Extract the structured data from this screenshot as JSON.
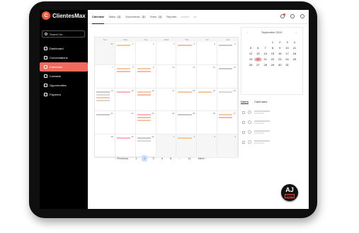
{
  "brand": {
    "name": "ClientesMax",
    "logo_letter": "C"
  },
  "sidebar": {
    "search_placeholder": "Search for...",
    "items": [
      {
        "label": "Dashboard",
        "icon": "home-icon"
      },
      {
        "label": "Conversations",
        "icon": "chat-icon"
      },
      {
        "label": "Calendars",
        "icon": "calendar-icon",
        "active": true
      },
      {
        "label": "Contacts",
        "icon": "contacts-icon"
      },
      {
        "label": "Opportunities",
        "icon": "filter-icon"
      },
      {
        "label": "Payment",
        "icon": "card-icon"
      }
    ]
  },
  "topbar": {
    "tabs": [
      {
        "label": "Calendar",
        "active": true
      },
      {
        "label": "Tasks",
        "badge": "1"
      },
      {
        "label": "Documents",
        "badge": "1"
      },
      {
        "label": "Team",
        "badge": "1"
      },
      {
        "label": "Reports"
      },
      {
        "label": "Assets",
        "disabled": true
      }
    ],
    "more": "•••",
    "icons": [
      "bell-icon",
      "gear-icon",
      "user-icon"
    ],
    "notification_count": "1"
  },
  "calendar": {
    "weekday_headers": [
      "Sun",
      "Mon",
      "Tue",
      "Wed",
      "Thu",
      "Fri",
      "Sat"
    ],
    "weeks": [
      [
        {
          "n": "31",
          "dim": true
        },
        {
          "n": "1"
        },
        {
          "n": "2"
        },
        {
          "n": "3"
        },
        {
          "n": "4"
        },
        {
          "n": "5"
        },
        {
          "n": "6"
        }
      ],
      [
        {
          "n": "7"
        },
        {
          "n": "8"
        },
        {
          "n": "9"
        },
        {
          "n": "10"
        },
        {
          "n": "11"
        },
        {
          "n": "12"
        },
        {
          "n": "13"
        }
      ],
      [
        {
          "n": "14"
        },
        {
          "n": "15"
        },
        {
          "n": "16"
        },
        {
          "n": "17"
        },
        {
          "n": "18"
        },
        {
          "n": "19"
        },
        {
          "n": "20"
        }
      ],
      [
        {
          "n": "21"
        },
        {
          "n": "22"
        },
        {
          "n": "23"
        },
        {
          "n": "24"
        },
        {
          "n": "25"
        },
        {
          "n": "26"
        },
        {
          "n": "27"
        }
      ],
      [
        {
          "n": "28"
        },
        {
          "n": "29"
        },
        {
          "n": "30"
        },
        {
          "n": "1",
          "dim": true
        },
        {
          "n": "2",
          "dim": true
        },
        {
          "n": "3",
          "dim": true
        },
        {
          "n": "4",
          "dim": true
        }
      ]
    ]
  },
  "mini_calendar": {
    "month_label": "September 2021",
    "prev": "‹",
    "next": "›",
    "days": [
      "1",
      "2",
      "3",
      "4",
      "5",
      "6",
      "7",
      "8",
      "9",
      "10",
      "11",
      "12",
      "13",
      "14",
      "15",
      "16",
      "17",
      "18",
      "19",
      "20",
      "21",
      "22",
      "23",
      "24",
      "25",
      "26",
      "27",
      "28",
      "29",
      "30",
      "31"
    ],
    "selected": "20"
  },
  "users_panel": {
    "tabs": [
      "Users",
      "Calendars"
    ],
    "rows": [
      1,
      2,
      3,
      4
    ]
  },
  "pagination": {
    "prev": "‹ Previous",
    "pages": [
      "1",
      "2",
      "3",
      "4",
      "5",
      "...",
      "11"
    ],
    "active": "2",
    "next": "Next ›"
  },
  "badge": {
    "main": "AJ",
    "sub": "7776"
  }
}
